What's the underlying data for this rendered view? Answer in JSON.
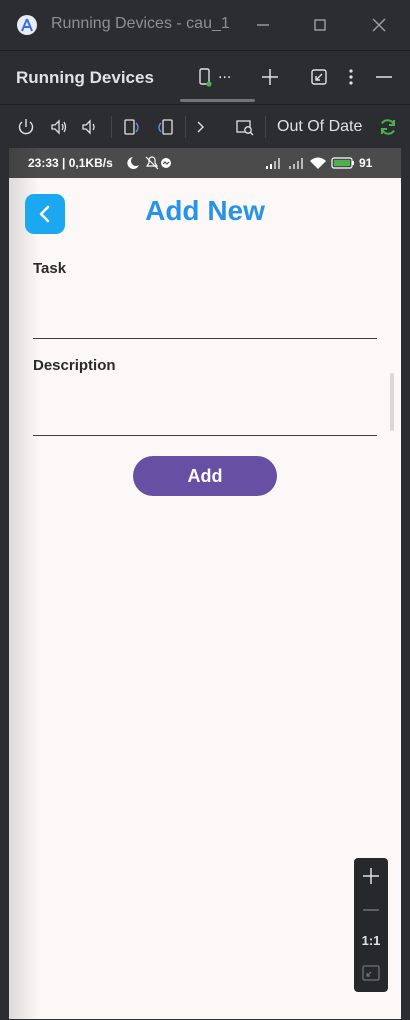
{
  "window": {
    "title": "Running Devices - cau_1",
    "controls": [
      "minimize-icon",
      "maximize-icon",
      "close-icon"
    ]
  },
  "tool_window": {
    "title": "Running Devices",
    "tab_dots": "...",
    "actions": [
      "add-icon",
      "restore-icon",
      "more-icon",
      "hide-icon"
    ]
  },
  "toolbar": {
    "buttons": [
      "power-icon",
      "volume-up-icon",
      "volume-down-icon",
      "rotate-left-icon",
      "rotate-right-icon",
      "more-chevron-icon",
      "screenshot-icon"
    ],
    "status_text": "Out Of Date",
    "colors": {
      "refresh": "#4caf50"
    }
  },
  "device": {
    "status_bar": {
      "left": "23:33 | 0,1KB/s",
      "battery": "91"
    },
    "app": {
      "title": "Add New",
      "task_label": "Task",
      "task_value": "",
      "description_label": "Description",
      "description_value": "",
      "add_button": "Add",
      "colors": {
        "title": "#2993e6",
        "back_button": "#1ba8f0",
        "add_button": "#674fa3"
      }
    }
  },
  "zoom": {
    "ratio_label": "1:1"
  }
}
